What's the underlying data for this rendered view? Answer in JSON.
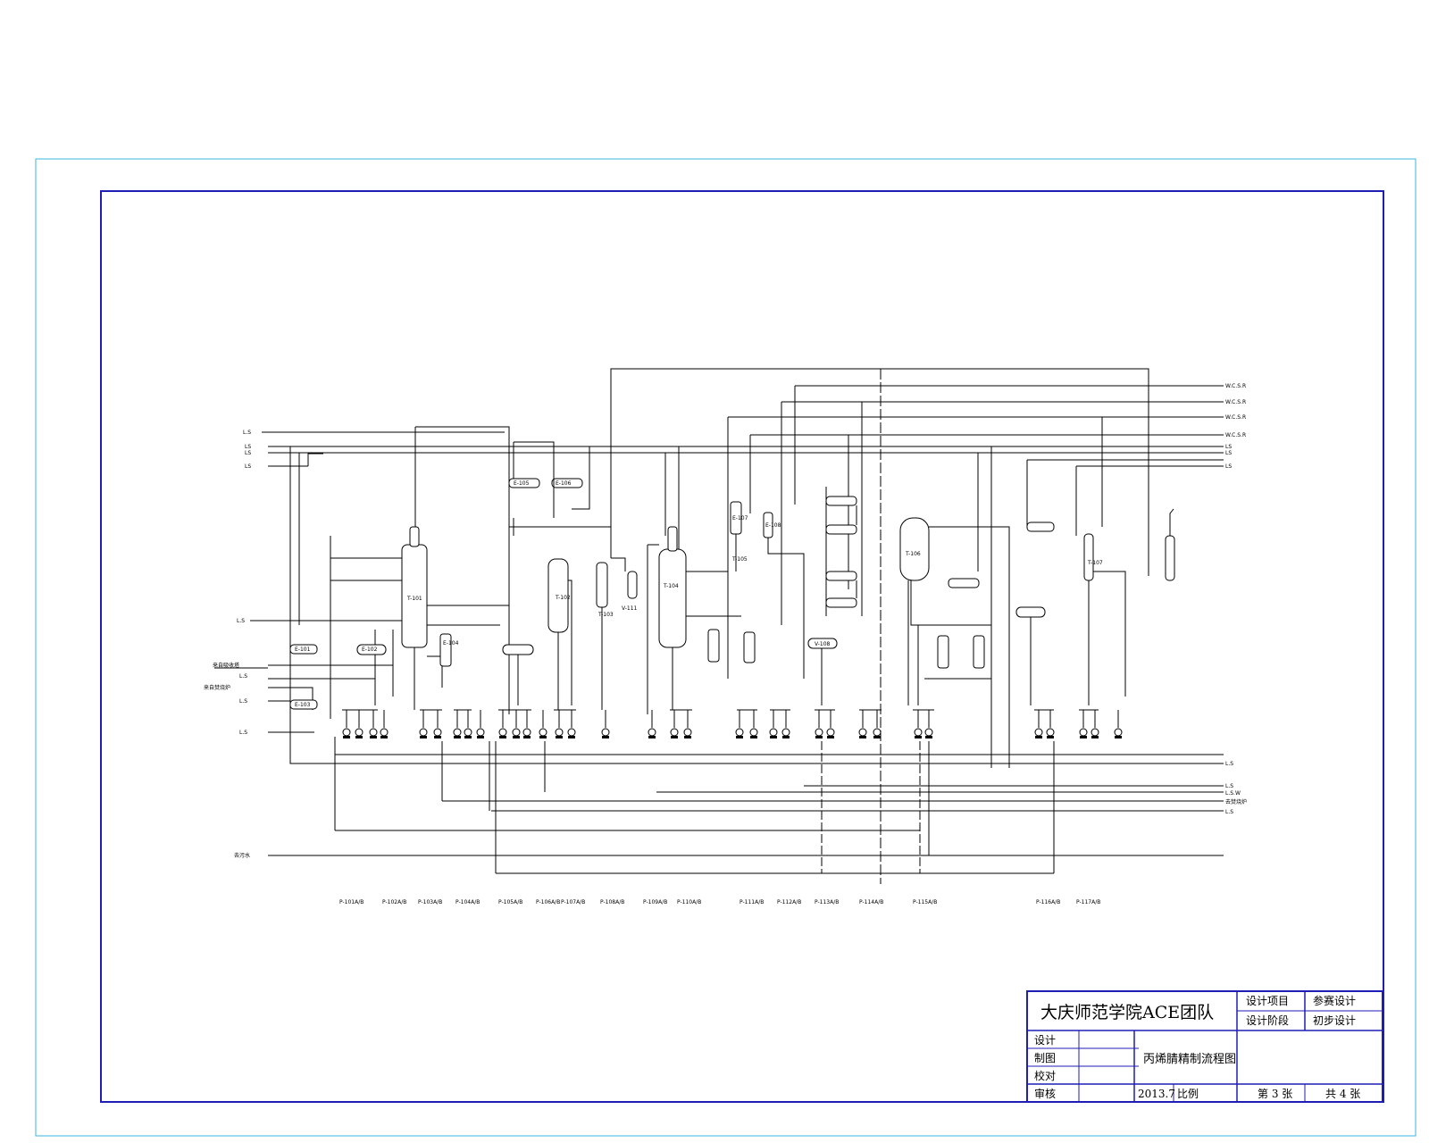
{
  "title_block": {
    "organization": "大庆师范学院ACE团队",
    "design_project_label": "设计项目",
    "design_project_value": "参赛设计",
    "design_stage_label": "设计阶段",
    "design_stage_value": "初步设计",
    "design_label": "设计",
    "drawing_label": "制图",
    "proofread_label": "校对",
    "review_label": "审核",
    "drawing_name": "丙烯腈精制流程图",
    "date": "2013.7",
    "scale_label": "比例",
    "sheet_number": "第 3 张",
    "total_sheets": "共 4 张"
  },
  "diagram": {
    "equipment_labels": [
      "T-101",
      "T-102",
      "T-103",
      "T-104",
      "T-105",
      "T-106",
      "T-107",
      "V-108",
      "V-111",
      "E-101",
      "E-102",
      "E-103",
      "E-104",
      "E-105",
      "E-106",
      "E-107",
      "E-108"
    ],
    "right_stream_labels": [
      "W.C.S.R",
      "W.C.S.R",
      "W.C.S.R",
      "W.C.S.R",
      "LS",
      "LS",
      "LS",
      "L.S",
      "L.S",
      "L.S.W",
      "去焚烧炉",
      "L.S"
    ],
    "left_stream_labels": [
      "L.S",
      "LS",
      "LS",
      "LS",
      "L.S",
      "来自吸收塔",
      "L.S",
      "来自焚烧炉",
      "L.S",
      "L.S"
    ],
    "pump_labels": [
      "P-101A/B",
      "P-102A/B",
      "P-103A/B",
      "P-104A/B",
      "P-105A/B",
      "P-106A/B",
      "P-107A/B",
      "P-108A/B",
      "P-109A/B",
      "P-110A/B",
      "P-111A/B",
      "P-112A/B",
      "P-113A/B",
      "P-114A/B",
      "P-115A/B",
      "P-116A/B",
      "P-117A/B"
    ],
    "bottom_left_label": "去污水"
  }
}
